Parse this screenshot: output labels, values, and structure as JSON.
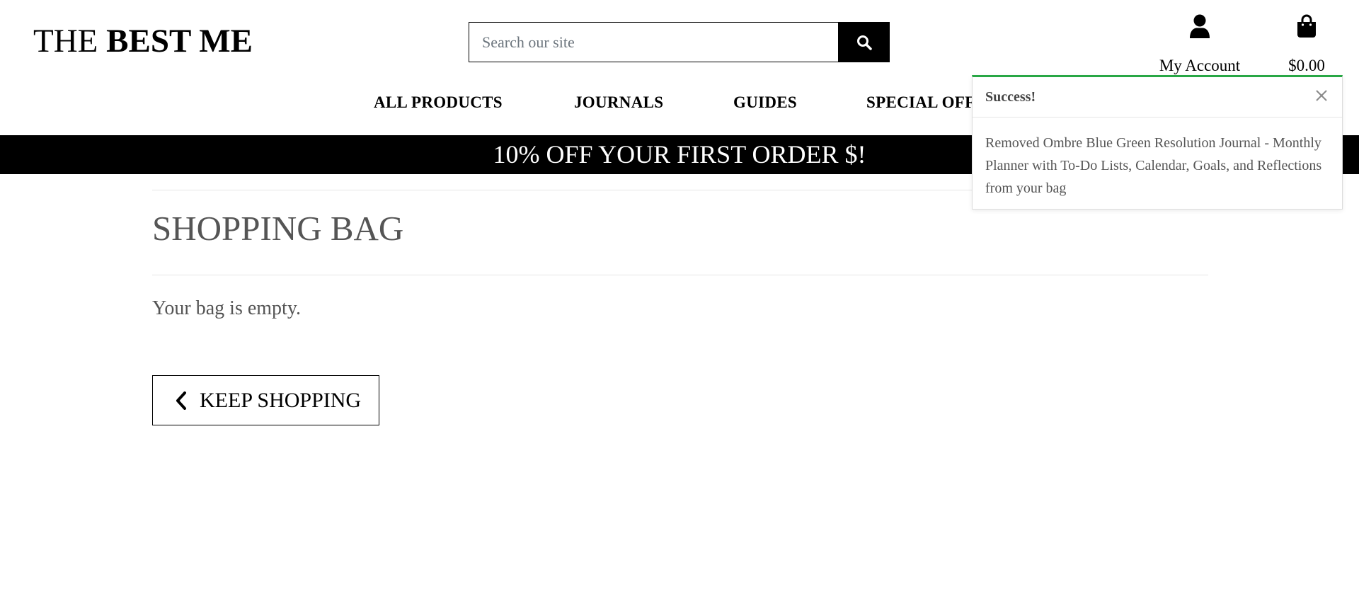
{
  "header": {
    "logo_light": "THE ",
    "logo_bold": "BEST ME",
    "search_placeholder": "Search our site",
    "account_label": "My Account",
    "bag_total": "$0.00"
  },
  "nav": {
    "items": [
      "ALL PRODUCTS",
      "JOURNALS",
      "GUIDES",
      "SPECIAL OFF"
    ]
  },
  "banner": {
    "text": "10% OFF YOUR FIRST ORDER $!"
  },
  "main": {
    "title": "SHOPPING BAG",
    "empty_message": "Your bag is empty.",
    "keep_shopping_label": "KEEP SHOPPING"
  },
  "toast": {
    "title": "Success!",
    "message": "Removed Ombre Blue Green Resolution Journal - Monthly Planner with To-Do Lists, Calendar, Goals, and Reflections from your bag",
    "accent_color": "#28a745"
  },
  "icons": {
    "search": "search-icon",
    "account": "user-icon",
    "bag": "shopping-bag-icon",
    "back": "chevron-left-icon",
    "close": "close-icon"
  }
}
